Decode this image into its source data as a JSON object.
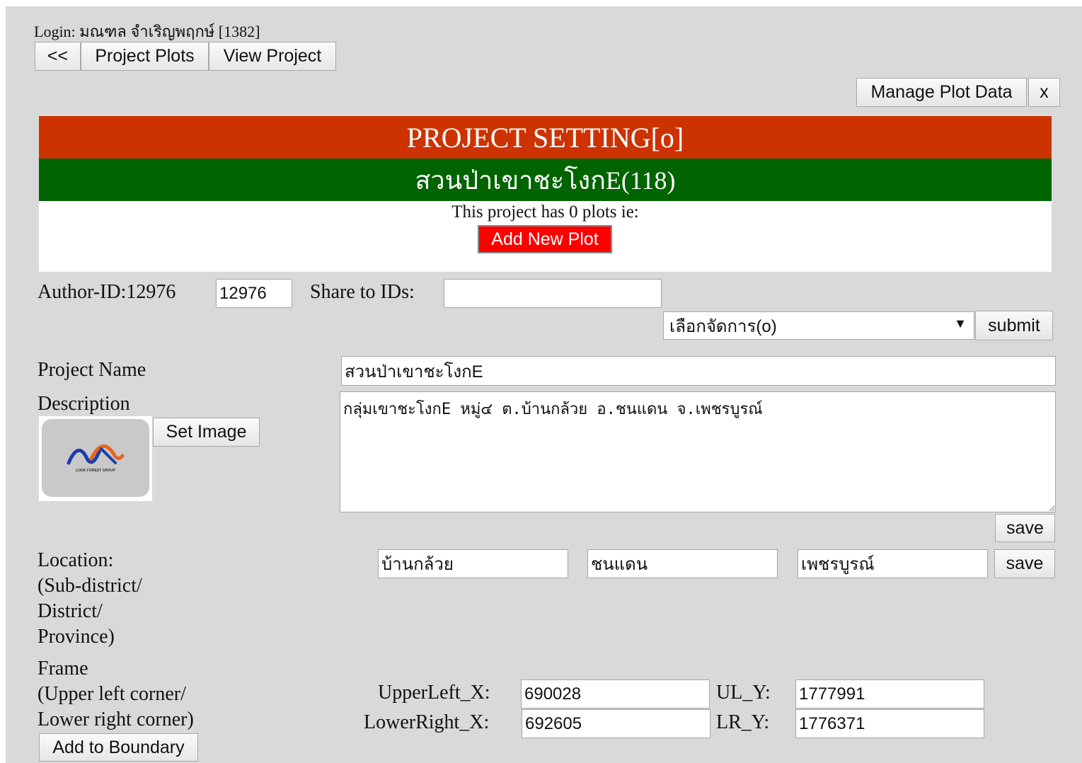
{
  "login": {
    "text": "Login: มณฑล จำเริญพฤกษ์ [1382]"
  },
  "nav": {
    "back_label": "<<",
    "project_plots_label": "Project Plots",
    "view_project_label": "View Project"
  },
  "top_actions": {
    "manage_plot_data_label": "Manage Plot Data",
    "close_label": "x"
  },
  "header": {
    "title": "PROJECT SETTING[o]",
    "project_name": "สวนป่าเขาชะโงกE(118)",
    "plots_text": "This project has 0 plots ie:",
    "add_plot_label": "Add New Plot",
    "colors": {
      "title_bg": "#cc3300",
      "name_bg": "#006400",
      "add_plot_bg": "#ff0000"
    }
  },
  "author": {
    "label": "Author-ID:12976",
    "value": "12976",
    "share_label": "Share to IDs:",
    "share_value": ""
  },
  "manage": {
    "select_value": "เลือกจัดการ(o)",
    "submit_label": "submit"
  },
  "project": {
    "name_label": "Project Name",
    "name_value": "สวนป่าเขาชะโงกE",
    "description_label": "Description",
    "description_value": "กลุ่มเขาชะโงกE หมู่๔ ต.บ้านกล้วย อ.ชนแดน จ.เพชรบูรณ์",
    "set_image_label": "Set Image",
    "logo_icon": "look-forest-group-logo",
    "logo_text": "LOOK FOREST GROUP",
    "save_label": "save"
  },
  "location": {
    "label_lines": [
      "Location:",
      "(Sub-district/",
      "District/",
      "Province)"
    ],
    "subdistrict": "บ้านกล้วย",
    "district": "ชนแดน",
    "province": "เพชรบูรณ์",
    "save_label": "save"
  },
  "frame": {
    "label_lines": [
      "Frame",
      "(Upper left corner/",
      "Lower right corner)"
    ],
    "upper_left_x_label": "UpperLeft_X:",
    "upper_left_x": "690028",
    "ul_y_label": "UL_Y:",
    "ul_y": "1777991",
    "lower_right_x_label": "LowerRight_X:",
    "lower_right_x": "692605",
    "lr_y_label": "LR_Y:",
    "lr_y": "1776371",
    "add_boundary_label": "Add to Boundary"
  }
}
